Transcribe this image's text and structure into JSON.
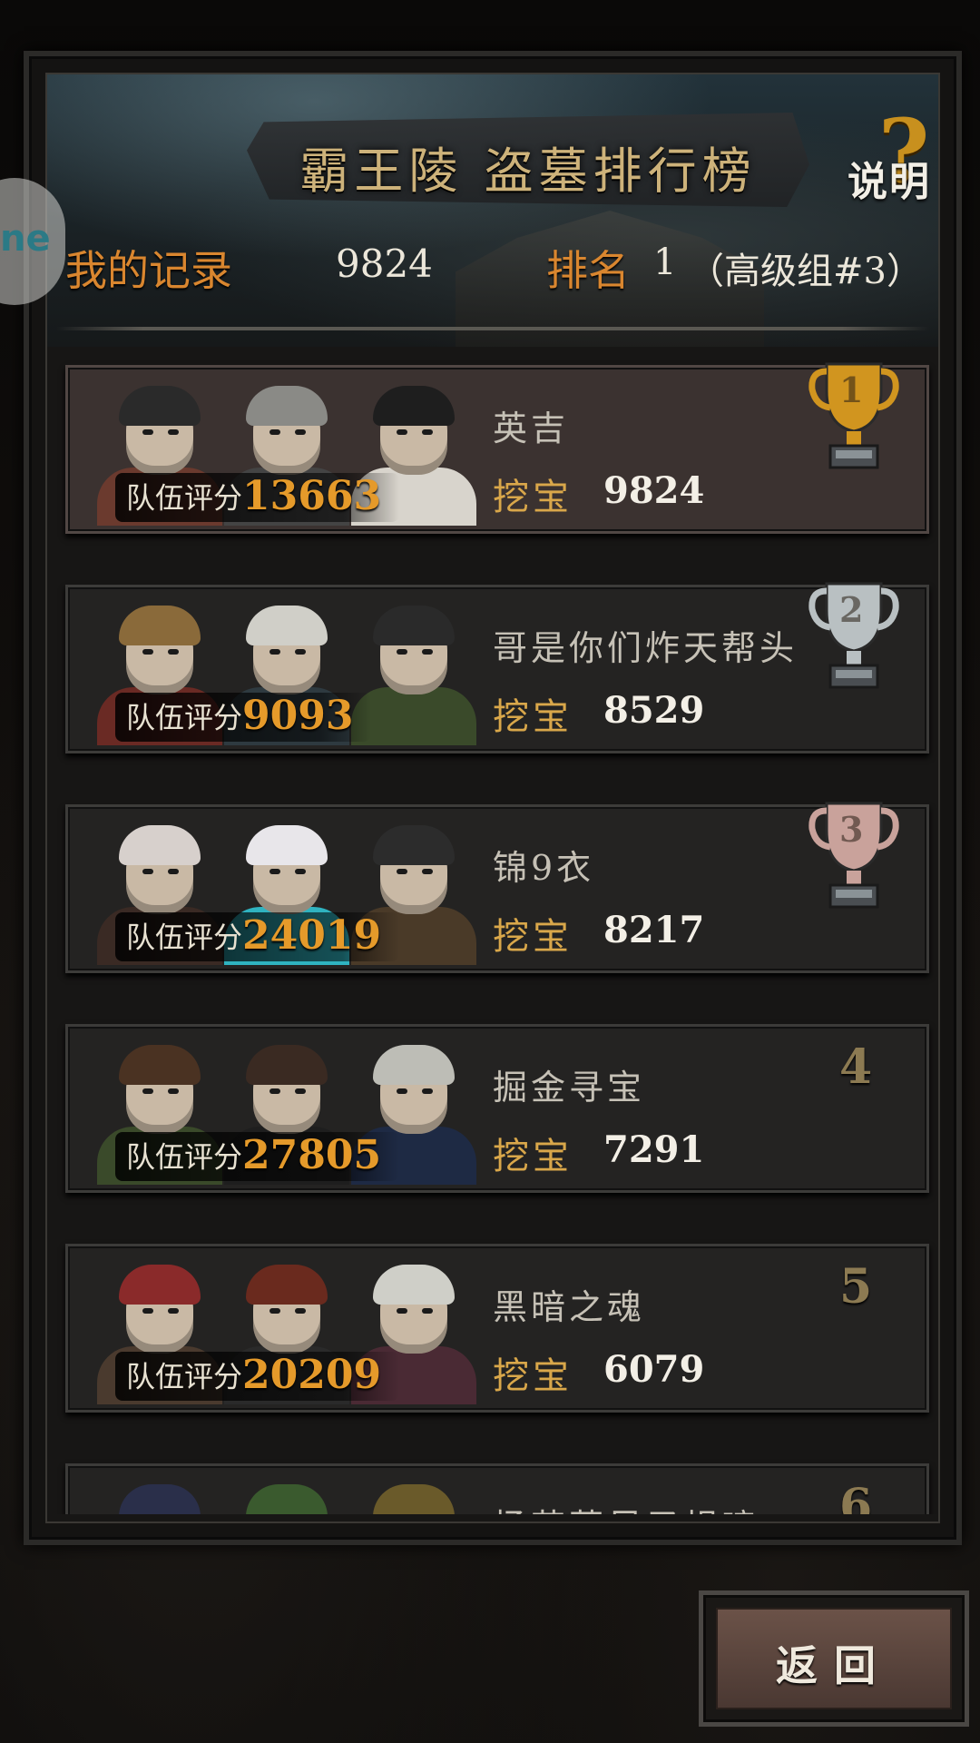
{
  "header": {
    "title": "霸王陵 盗墓排行榜",
    "help_label": "说明",
    "help_icon": "question-mark-icon"
  },
  "my_record": {
    "label": "我的记录",
    "value": "9824",
    "rank_label": "排名",
    "rank_value": "1",
    "group": "（高级组#3）"
  },
  "side_tag": {
    "text": "ne"
  },
  "score_label": "队伍评分",
  "dig_label": "挖宝",
  "entries": [
    {
      "rank": "1",
      "name": "英吉",
      "team_score": "13663",
      "dig": "9824",
      "trophy": "gold"
    },
    {
      "rank": "2",
      "name": "哥是你们炸天帮头",
      "team_score": "9093",
      "dig": "8529",
      "trophy": "silver"
    },
    {
      "rank": "3",
      "name": "锦9衣",
      "team_score": "24019",
      "dig": "8217",
      "trophy": "bronze"
    },
    {
      "rank": "4",
      "name": "掘金寻宝",
      "team_score": "27805",
      "dig": "7291"
    },
    {
      "rank": "5",
      "name": "黑暗之魂",
      "team_score": "20209",
      "dig": "6079"
    },
    {
      "rank": "6",
      "name": "杨花落尽子规啼",
      "team_score": "",
      "dig": ""
    }
  ],
  "back_button": {
    "label": "返回"
  },
  "colors": {
    "accent_orange": "#d9862f",
    "gold_title": "#cdb27a",
    "trophy_gold": "#d1951f",
    "trophy_silver": "#b9c0c2",
    "trophy_bronze": "#c9a29b"
  }
}
